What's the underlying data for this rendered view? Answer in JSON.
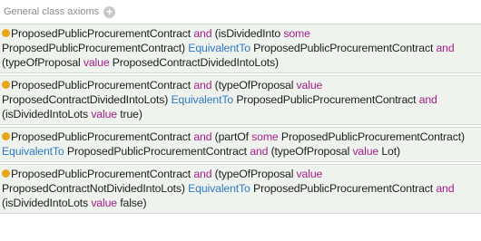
{
  "header": {
    "title": "General class axioms",
    "add_glyph": "+"
  },
  "axioms": [
    {
      "lines": [
        [
          [
            "cl",
            "ProposedPublicProcurementContract "
          ],
          [
            "kw",
            "and"
          ],
          [
            "cl",
            " (isDividedInto "
          ],
          [
            "kw",
            "some"
          ]
        ],
        [
          [
            "cl",
            "ProposedPublicProcurementContract) "
          ],
          [
            "eq",
            "EquivalentTo"
          ],
          [
            "cl",
            " ProposedPublicProcurementContract "
          ],
          [
            "kw",
            "and"
          ]
        ],
        [
          [
            "cl",
            "(typeOfProposal "
          ],
          [
            "kw",
            "value"
          ],
          [
            "cl",
            " ProposedContractDividedIntoLots)"
          ]
        ]
      ]
    },
    {
      "lines": [
        [
          [
            "cl",
            "ProposedPublicProcurementContract "
          ],
          [
            "kw",
            "and"
          ],
          [
            "cl",
            " (typeOfProposal "
          ],
          [
            "kw",
            "value"
          ]
        ],
        [
          [
            "cl",
            "ProposedContractDividedIntoLots) "
          ],
          [
            "eq",
            "EquivalentTo"
          ],
          [
            "cl",
            " ProposedPublicProcurementContract "
          ],
          [
            "kw",
            "and"
          ]
        ],
        [
          [
            "cl",
            "(isDividedIntoLots "
          ],
          [
            "kw",
            "value"
          ],
          [
            "cl",
            " true)"
          ]
        ]
      ]
    },
    {
      "lines": [
        [
          [
            "cl",
            "ProposedPublicProcurementContract "
          ],
          [
            "kw",
            "and"
          ],
          [
            "cl",
            " (partOf "
          ],
          [
            "kw",
            "some"
          ],
          [
            "cl",
            " ProposedPublicProcurementContract)"
          ]
        ],
        [
          [
            "eq",
            "EquivalentTo"
          ],
          [
            "cl",
            " ProposedPublicProcurementContract "
          ],
          [
            "kw",
            "and"
          ],
          [
            "cl",
            " (typeOfProposal "
          ],
          [
            "kw",
            "value"
          ],
          [
            "cl",
            " Lot)"
          ]
        ]
      ]
    },
    {
      "lines": [
        [
          [
            "cl",
            "ProposedPublicProcurementContract "
          ],
          [
            "kw",
            "and"
          ],
          [
            "cl",
            " (typeOfProposal "
          ],
          [
            "kw",
            "value"
          ]
        ],
        [
          [
            "cl",
            "ProposedContractNotDividedIntoLots) "
          ],
          [
            "eq",
            "EquivalentTo"
          ],
          [
            "cl",
            " ProposedPublicProcurementContract "
          ],
          [
            "kw",
            "and"
          ]
        ],
        [
          [
            "cl",
            "(isDividedIntoLots "
          ],
          [
            "kw",
            "value"
          ],
          [
            "cl",
            " false)"
          ]
        ]
      ]
    }
  ]
}
